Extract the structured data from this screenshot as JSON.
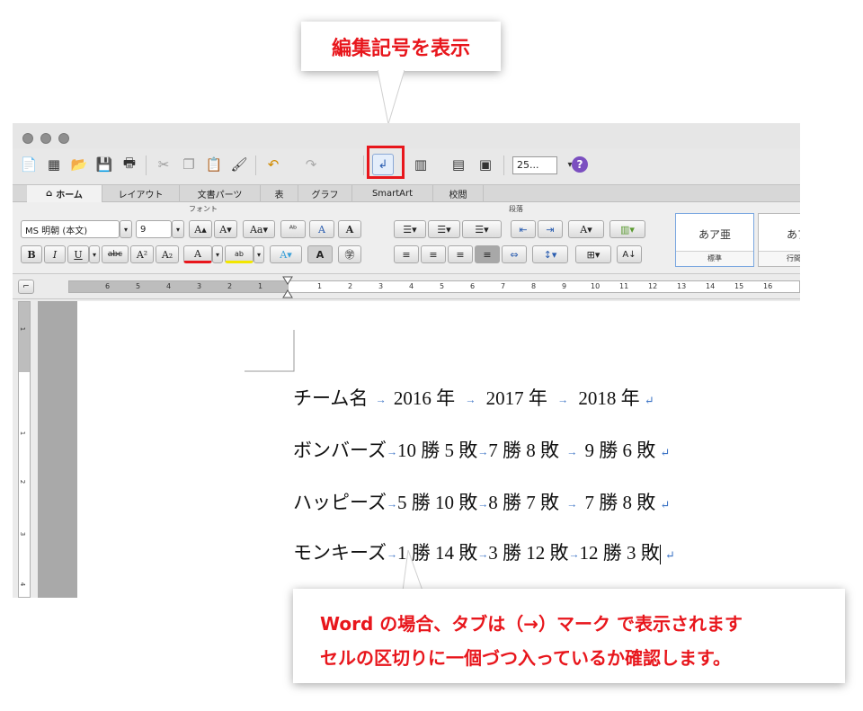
{
  "callouts": {
    "top": "編集記号を表示",
    "bottom_line1": "Word の場合、タブは（→）マーク で表示されます",
    "bottom_line2": "セルの区切りに一個づつ入っているか確認します。"
  },
  "tabs": [
    "ホーム",
    "レイアウト",
    "文書パーツ",
    "表",
    "グラフ",
    "SmartArt",
    "校閲"
  ],
  "ribbon": {
    "font_group_label": "フォント",
    "paragraph_group_label": "段落",
    "font_name": "MS 明朝 (本文)",
    "font_size": "9",
    "style_sample": "あア亜",
    "style_sample_2": "あア",
    "style_name_1": "標準",
    "style_name_2": "行間詰"
  },
  "toolbar": {
    "zoom": "25..."
  },
  "ruler_labels": [
    "6",
    "5",
    "4",
    "3",
    "2",
    "1",
    "1",
    "2",
    "3",
    "4",
    "5",
    "6",
    "7",
    "8",
    "9",
    "10",
    "11",
    "12",
    "13",
    "14",
    "15",
    "16"
  ],
  "vruler_labels": [
    "1",
    "1",
    "2",
    "3",
    "4"
  ],
  "document": {
    "rows": [
      [
        "チーム名",
        "2016 年",
        "2017 年",
        "2018 年"
      ],
      [
        "ボンバーズ",
        "10 勝 5 敗",
        "7 勝 8 敗",
        "9 勝 6 敗"
      ],
      [
        "ハッピーズ",
        "5 勝 10 敗",
        "8 勝 7 敗",
        "7 勝 8 敗"
      ],
      [
        "モンキーズ",
        "1 勝 14 敗",
        "3 勝 12 敗",
        "12 勝 3 敗"
      ]
    ]
  },
  "colors": {
    "accent_red": "#e8161c",
    "tab_mark_blue": "#3b73c5"
  }
}
